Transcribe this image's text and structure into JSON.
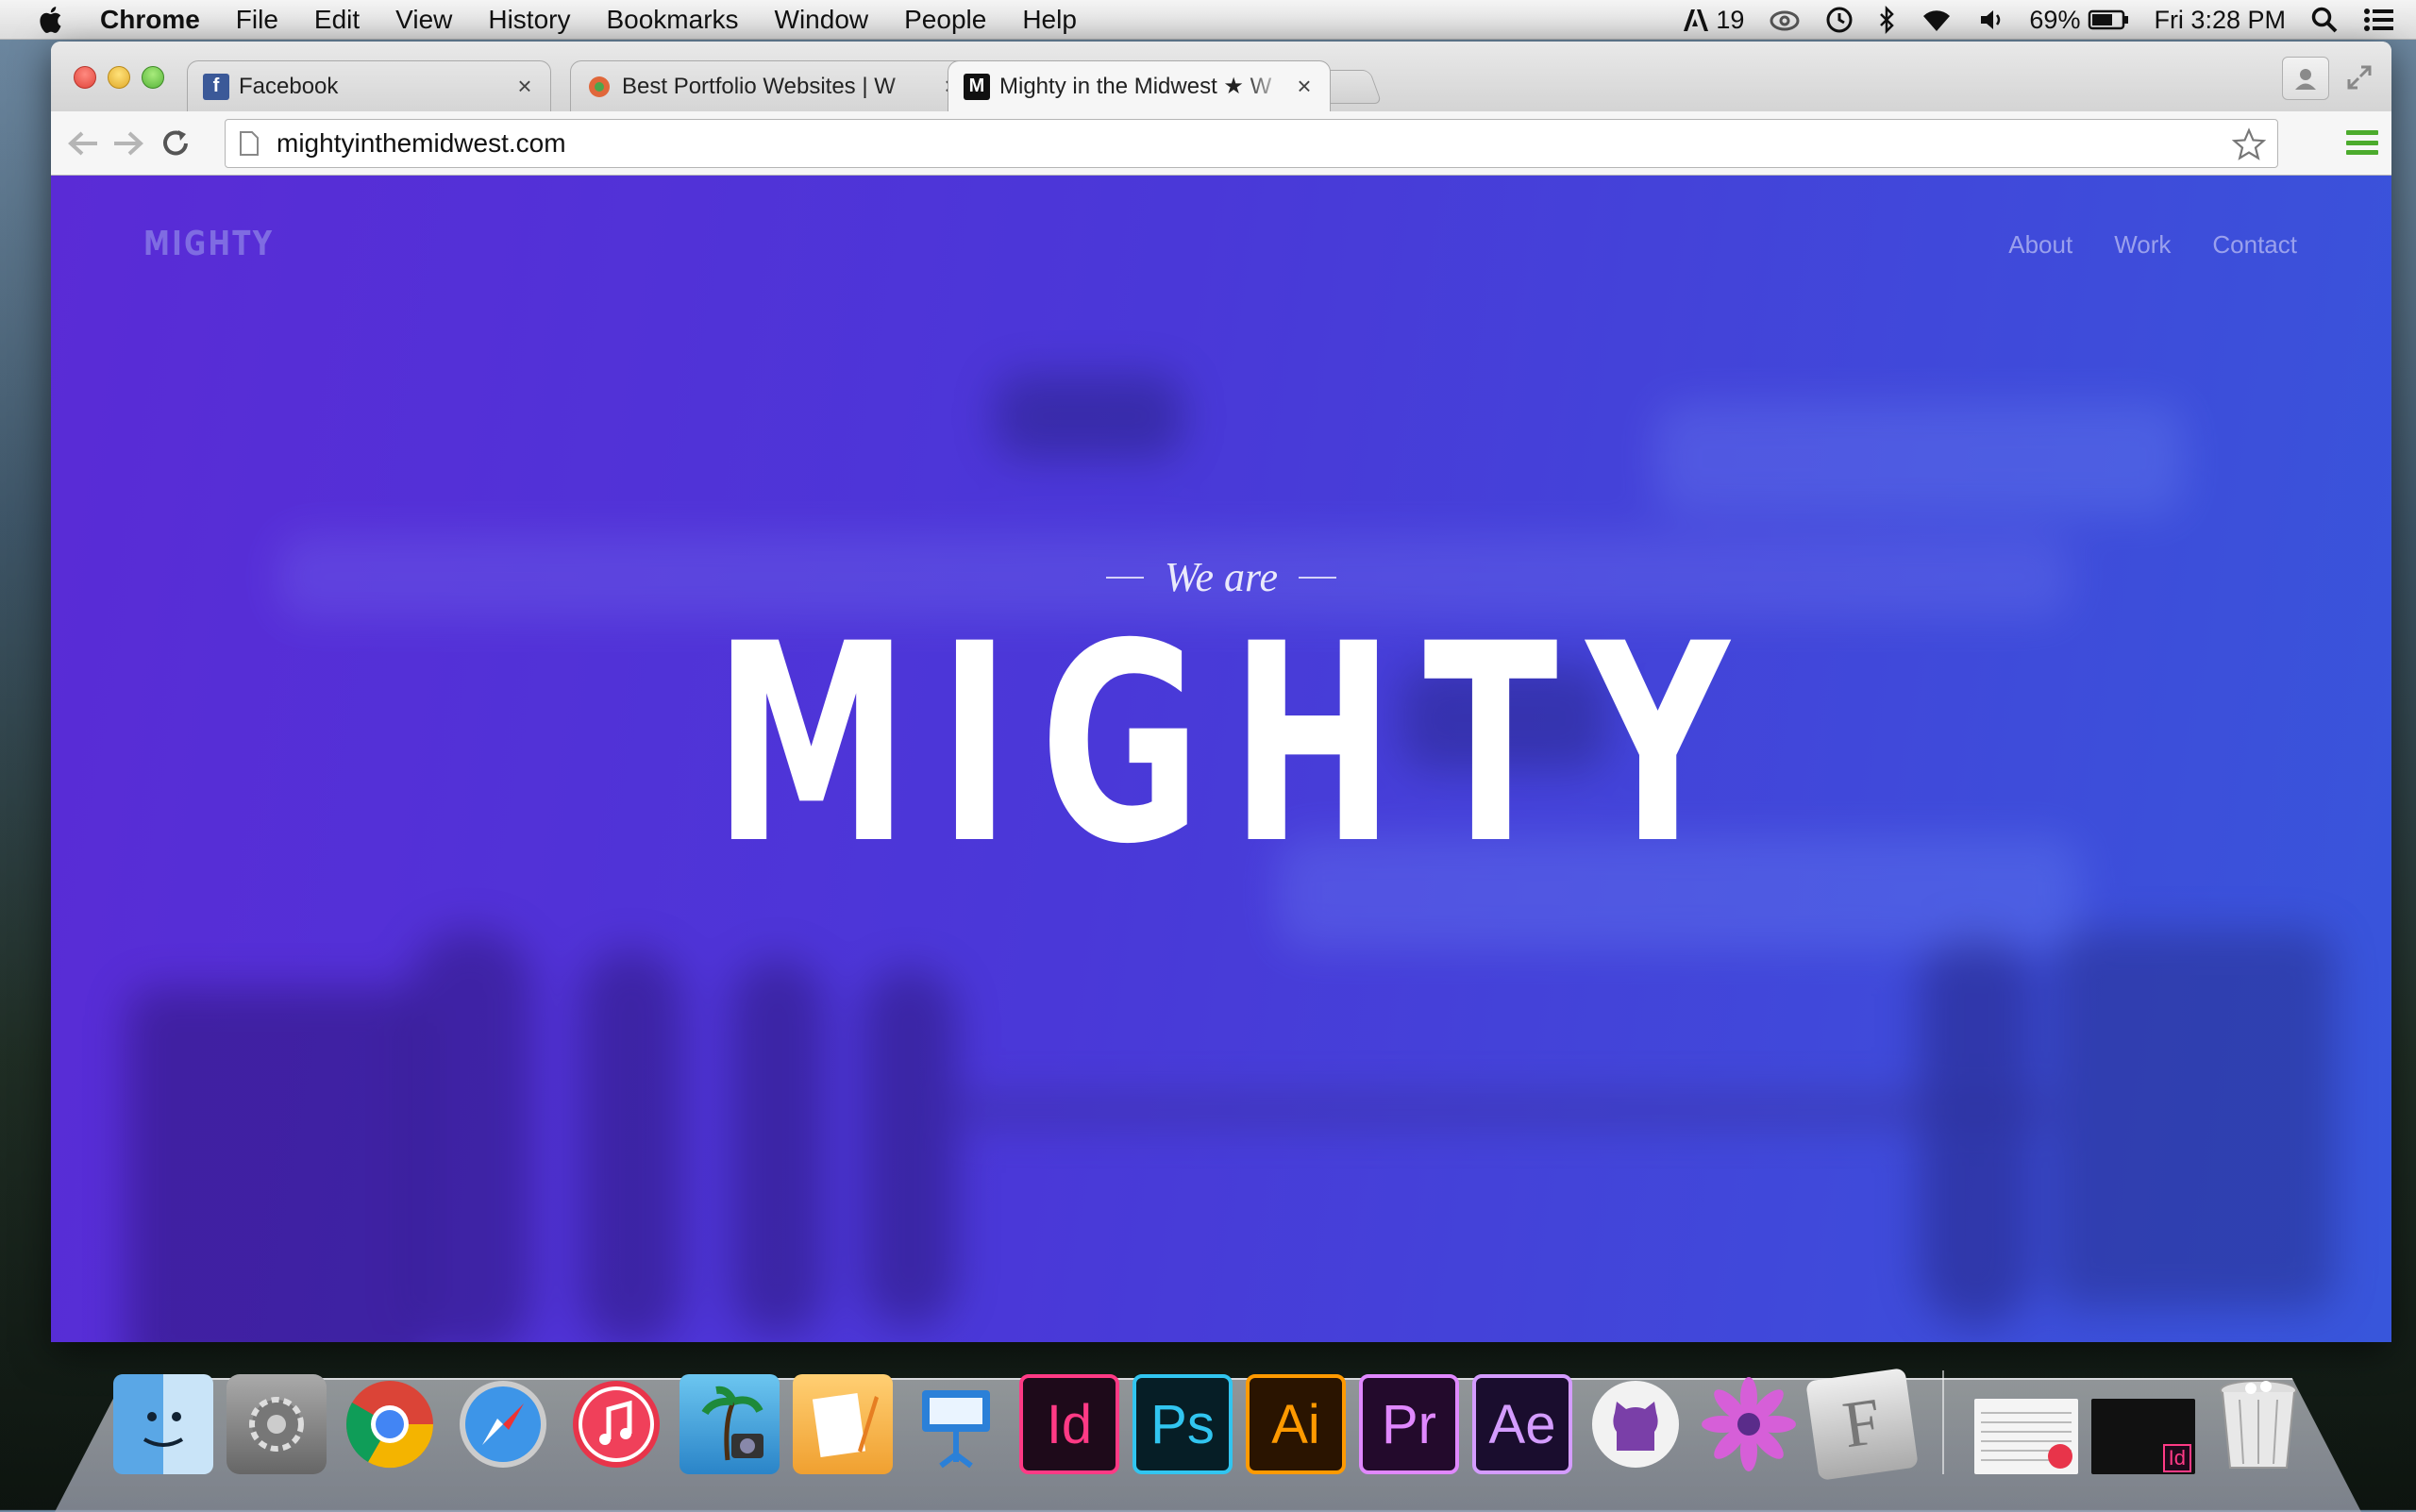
{
  "menubar": {
    "app_name": "Chrome",
    "items": [
      "File",
      "Edit",
      "View",
      "History",
      "Bookmarks",
      "Window",
      "People",
      "Help"
    ],
    "status": {
      "adobe_count": "19",
      "battery": "69%",
      "clock": "Fri 3:28 PM"
    }
  },
  "tabs": [
    {
      "title": "Facebook",
      "favicon": "facebook-icon"
    },
    {
      "title": "Best Portfolio Websites | W",
      "favicon": "portfolio-icon"
    },
    {
      "title": "Mighty in the Midwest ★ W",
      "favicon": "mighty-icon",
      "active": true
    }
  ],
  "omnibox": {
    "url": "mightyinthemidwest.com"
  },
  "site": {
    "logo": "MIGHTY",
    "nav": [
      "About",
      "Work",
      "Contact"
    ],
    "tagline": "We are",
    "headline": "MIGHTY"
  },
  "dock": {
    "apps": [
      "finder-icon",
      "system-preferences-icon",
      "chrome-icon",
      "safari-icon",
      "itunes-icon",
      "iphoto-icon",
      "pages-icon",
      "keynote-icon",
      "indesign-icon",
      "photoshop-icon",
      "illustrator-icon",
      "premiere-icon",
      "after-effects-icon",
      "github-icon",
      "flower-icon",
      "fontbook-icon"
    ],
    "adobe_labels": {
      "indesign": "Id",
      "photoshop": "Ps",
      "illustrator": "Ai",
      "premiere": "Pr",
      "after_effects": "Ae"
    },
    "adobe_colors": {
      "indesign": "#ff3a85",
      "photoshop": "#31c5f0",
      "illustrator": "#ff9a00",
      "premiere": "#e088ff",
      "after_effects": "#d49cff"
    },
    "minimized_badge": "Id"
  },
  "colors": {
    "hero_start": "#5a2bd6",
    "hero_end": "#3856db",
    "menu_green": "#4cab2d"
  }
}
